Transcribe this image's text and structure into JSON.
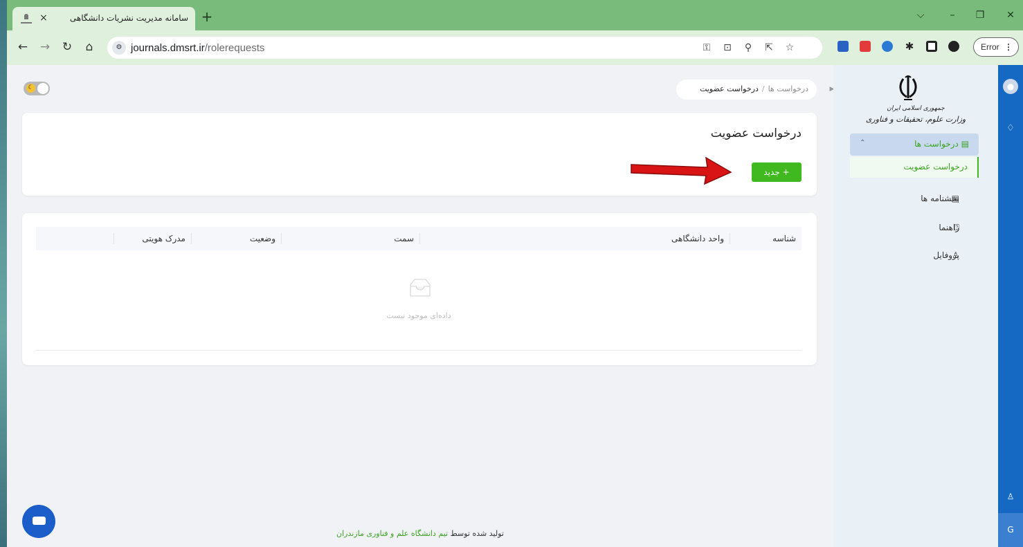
{
  "browser": {
    "tab_title": "سامانه مدیریت نشریات دانشگاهی",
    "tab_close": "×",
    "new_tab": "+",
    "url_host": "journals.dmsrt.ir",
    "url_path": "/rolerequests",
    "error_label": "Error",
    "window": {
      "min": "–",
      "restore": "❐",
      "close": "✕",
      "dropdown": "⌵"
    }
  },
  "breadcrumb": {
    "parent": "درخواست ها",
    "separator": "/",
    "current": "درخواست عضویت"
  },
  "header": {
    "title": "درخواست عضویت",
    "new_button": "+ جدید"
  },
  "table": {
    "columns": [
      "شناسه",
      "واحد دانشگاهی",
      "سمت",
      "وضعیت",
      "مدرک هویتی"
    ],
    "empty_text": "داده‌ای موجود نیست"
  },
  "sidebar": {
    "emblem_line1": "جمهوری اسلامی ایران",
    "emblem_line2": "وزارت علوم، تحقیقات و فناوری",
    "menu": {
      "requests": "درخواست ها",
      "membership": "درخواست عضویت",
      "circulars": "بخشنامه ها",
      "guide": "راهنما",
      "profile": "پروفایل"
    }
  },
  "footer": {
    "prefix": "تولید شده توسط",
    "team": "تیم دانشگاه علم و فناوری مازندران"
  },
  "rail": {
    "bottom_letter": "G"
  },
  "colors": {
    "accent_green": "#40b81f",
    "rail_blue": "#1669c2",
    "tab_green": "#78bb7b"
  }
}
